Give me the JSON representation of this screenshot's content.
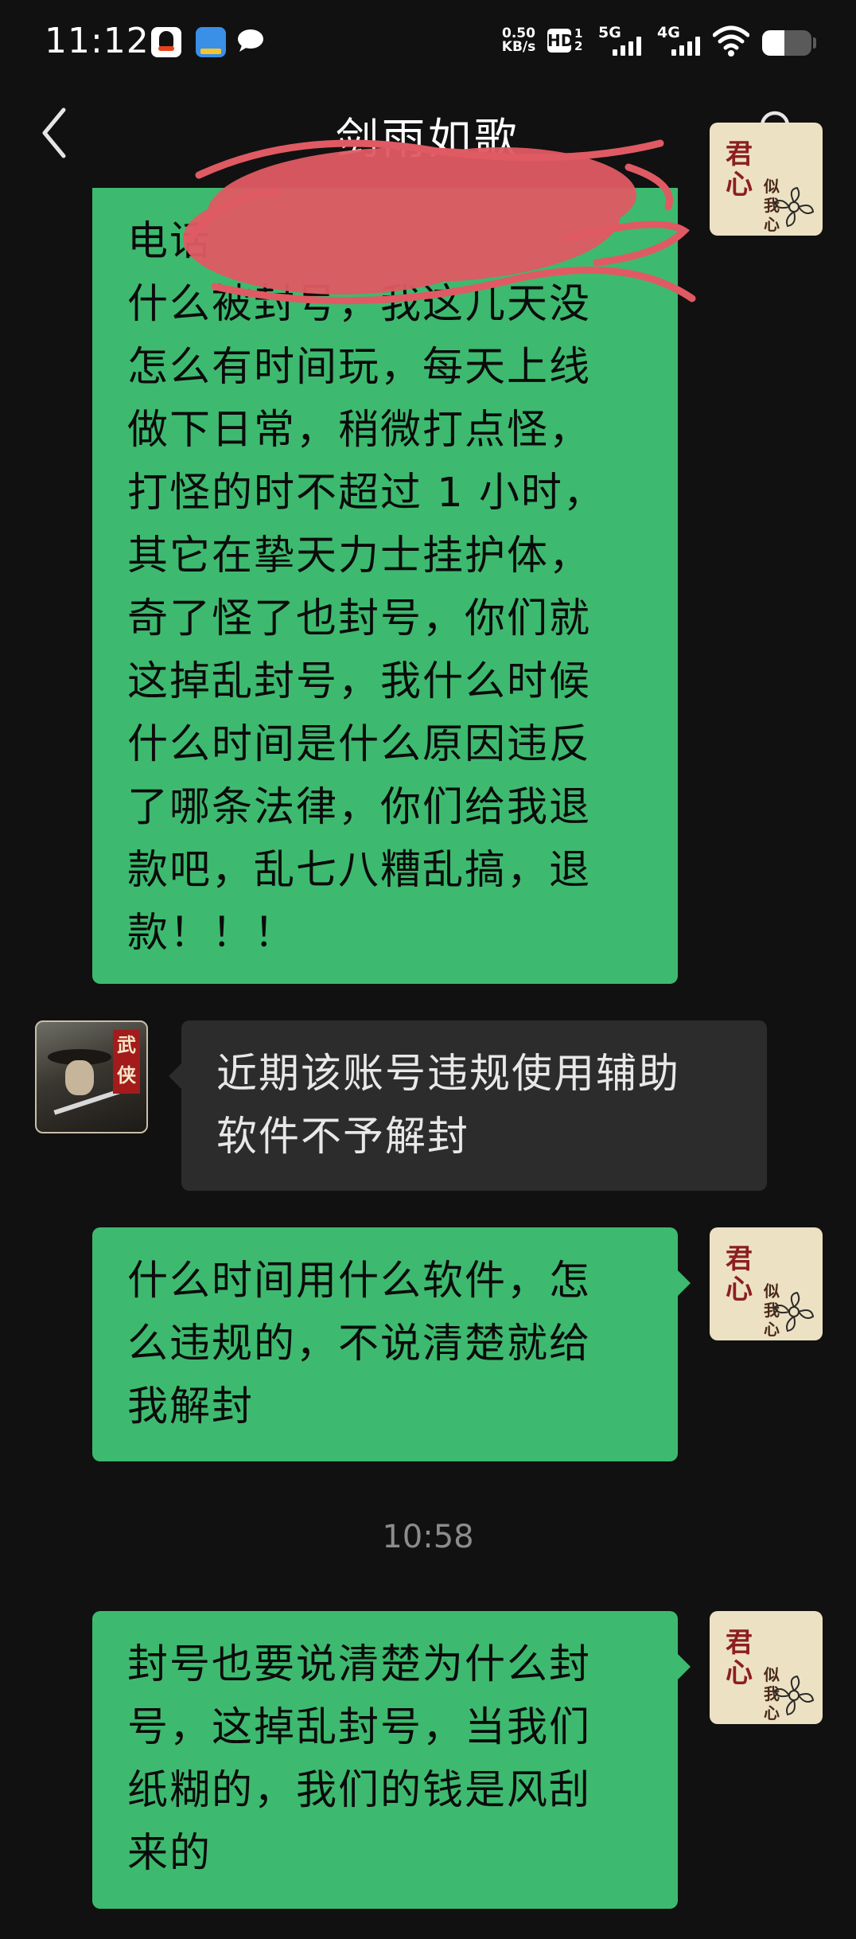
{
  "status_bar": {
    "time": "11:12",
    "net_speed_value": "0.50",
    "net_speed_unit": "KB/s",
    "hd_label": "HD",
    "hd_sub_top": "1",
    "hd_sub_bottom": "2",
    "signal_1_label": "5G",
    "signal_2_label": "4G",
    "battery_level": 0.45,
    "icons": [
      "qq-icon",
      "game-app-icon",
      "chat-bubble-icon",
      "hd-voice-icon",
      "5g-signal-icon",
      "4g-signal-icon",
      "wifi-icon",
      "battery-icon"
    ]
  },
  "header": {
    "title": "剑雨如歌",
    "back_icon": "back-chevron-icon",
    "profile_icon": "person-icon"
  },
  "messages": [
    {
      "direction": "outgoing",
      "text": "电话\n什么被封号，我这几天没\n怎么有时间玩，每天上线\n做下日常，稍微打点怪，\n打怪的时不超过 1 小时，\n其它在挚天力士挂护体，\n奇了怪了也封号，你们就\n这掉乱封号，我什么时候\n什么时间是什么原因违反\n了哪条法律，你们给我退\n款吧，乱七八糟乱搞，退\n款！！！"
    },
    {
      "direction": "incoming",
      "text": "近期该账号违规使用辅助\n软件不予解封"
    },
    {
      "direction": "outgoing",
      "text": "什么时间用什么软件，怎\n么违规的，不说清楚就给\n我解封"
    },
    {
      "timestamp": "10:58"
    },
    {
      "direction": "outgoing",
      "text": "封号也要说清楚为什么封\n号，这掉乱封号，当我们\n纸糊的，我们的钱是风刮\n来的"
    }
  ],
  "avatars": {
    "self_text": [
      "君",
      "心",
      "似",
      "我",
      "心"
    ],
    "other_badge": [
      "武",
      "侠"
    ]
  },
  "colors": {
    "background": "#111111",
    "outgoing_bubble": "#3dba6f",
    "incoming_bubble": "#2c2c2c",
    "timestamp": "#8c8c8c",
    "redaction": "#e05a63"
  }
}
